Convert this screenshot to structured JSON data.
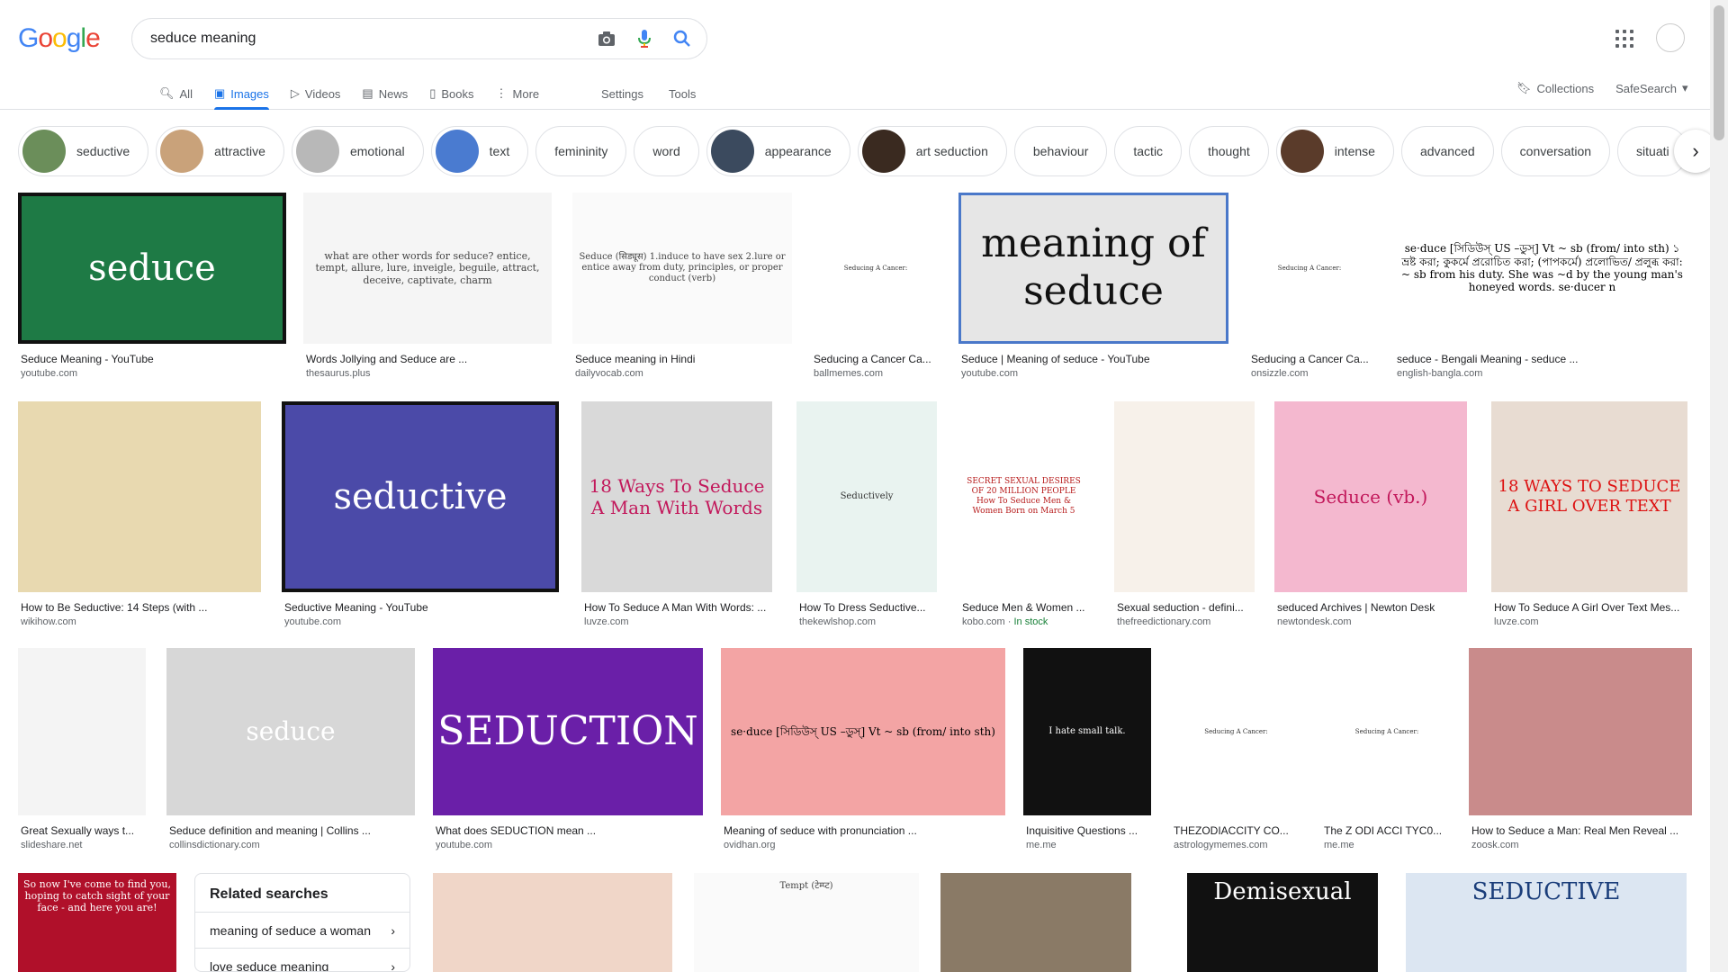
{
  "search": {
    "query": "seduce meaning"
  },
  "tabs": [
    {
      "label": "All"
    },
    {
      "label": "Images"
    },
    {
      "label": "Videos"
    },
    {
      "label": "News"
    },
    {
      "label": "Books"
    },
    {
      "label": "More"
    }
  ],
  "links": {
    "settings": "Settings",
    "tools": "Tools",
    "collections": "Collections",
    "safesearch": "SafeSearch"
  },
  "chips": [
    "seductive",
    "attractive",
    "emotional",
    "text",
    "femininity",
    "word",
    "appearance",
    "art seduction",
    "behaviour",
    "tactic",
    "thought",
    "intense",
    "advanced",
    "conversation",
    "situati"
  ],
  "results": [
    {
      "title": "Seduce Meaning - YouTube",
      "source": "youtube.com",
      "img_text": "seduce"
    },
    {
      "title": "Words Jollying and Seduce are ...",
      "source": "thesaurus.plus",
      "img_text": "what are other words for seduce?   entice, tempt, allure, lure, inveigle, beguile, attract, deceive, captivate, charm"
    },
    {
      "title": "Seduce meaning in Hindi",
      "source": "dailyvocab.com",
      "img_text": "Seduce (सिड्यूस) 1.induce to have sex 2.lure or entice away from duty, principles, or proper conduct (verb)"
    },
    {
      "title": "Seducing a Cancer Ca...",
      "source": "ballmemes.com",
      "img_text": "Seducing A Cancer:"
    },
    {
      "title": "Seduce | Meaning of seduce - YouTube",
      "source": "youtube.com",
      "img_text": "meaning of seduce"
    },
    {
      "title": "Seducing a Cancer Ca...",
      "source": "onsizzle.com",
      "img_text": "Seducing A Cancer:"
    },
    {
      "title": "seduce - Bengali Meaning - seduce ...",
      "source": "english-bangla.com",
      "img_text": "se·duce [সিডিউস্‌ US –ডুস্‌] Vt ~ sb (from/ into sth) ১ ভ্রষ্ট করা; কুকর্মে প্ররোচিত করা; (পাপকর্মে) প্রলোভিত/ প্রলুব্ধ করা: ~ sb from his duty. She was ~d by the young man's honeyed words. se·ducer n"
    },
    {
      "title": "How to Be Seductive: 14 Steps (with ...",
      "source": "wikihow.com",
      "img_text": ""
    },
    {
      "title": "Seductive Meaning - YouTube",
      "source": "youtube.com",
      "img_text": "seductive"
    },
    {
      "title": "How To Seduce A Man With Words: ...",
      "source": "luvze.com",
      "img_text": "18 Ways To Seduce A Man With Words"
    },
    {
      "title": "How To Dress Seductive...",
      "source": "thekewlshop.com",
      "img_text": "Seductively"
    },
    {
      "title": "Seduce Men & Women ...",
      "source": "kobo.com",
      "stock": "In stock",
      "img_text": "SECRET SEXUAL DESIRES OF 20 MILLION PEOPLE  How To Seduce Men & Women Born on March 5"
    },
    {
      "title": "Sexual seduction - defini...",
      "source": "thefreedictionary.com",
      "img_text": ""
    },
    {
      "title": "seduced Archives | Newton Desk",
      "source": "newtondesk.com",
      "img_text": "Seduce (vb.)"
    },
    {
      "title": "How To Seduce A Girl Over Text Mes...",
      "source": "luvze.com",
      "img_text": "18 WAYS TO SEDUCE A GIRL OVER TEXT"
    },
    {
      "title": "Great Sexually ways t...",
      "source": "slideshare.net",
      "img_text": ""
    },
    {
      "title": "Seduce definition and meaning | Collins ...",
      "source": "collinsdictionary.com",
      "img_text": "seduce"
    },
    {
      "title": "What does SEDUCTION mean ...",
      "source": "youtube.com",
      "img_text": "SEDUCTION"
    },
    {
      "title": "Meaning of seduce with pronunciation ...",
      "source": "ovidhan.org",
      "img_text": "se·duce [সিডিউস্‌ US –ডুস্‌] Vt ~ sb (from/ into sth)"
    },
    {
      "title": "Inquisitive Questions ...",
      "source": "me.me",
      "img_text": "I hate small talk."
    },
    {
      "title": "THEZODIACCITY CO...",
      "source": "astrologymemes.com",
      "img_text": "Seducing A Cancer:"
    },
    {
      "title": "The Z ODI ACCI TYC0...",
      "source": "me.me",
      "img_text": "Seducing A Cancer:"
    },
    {
      "title": "How to Seduce a Man: Real Men Reveal ...",
      "source": "zoosk.com",
      "img_text": ""
    }
  ],
  "bottom_row": [
    {
      "img_text": "So now I've come to find you, hoping to catch sight of your face - and here you are!"
    },
    {
      "img_text": ""
    },
    {
      "img_text": "Tempt (टेम्प्ट)"
    },
    {
      "img_text": ""
    },
    {
      "img_text": "Demisexual"
    },
    {
      "img_text": "SEDUCTIVE"
    }
  ],
  "related": {
    "heading": "Related searches",
    "items": [
      "meaning of seduce a woman",
      "love seduce meaning"
    ]
  },
  "colors": {
    "accent": "#1a73e8",
    "text": "#202124",
    "muted": "#5f6368"
  }
}
